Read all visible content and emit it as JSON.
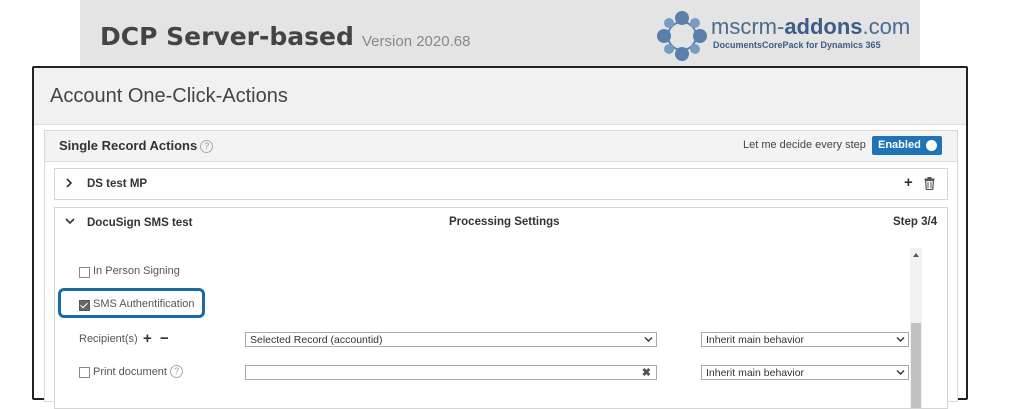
{
  "app": {
    "title": "DCP Server-based",
    "version": "Version 2020.68",
    "logo_prefix": "mscrm-",
    "logo_bold": "addons",
    "logo_suffix": ".com",
    "logo_tagline": "DocumentsCorePack for Dynamics 365"
  },
  "dialog": {
    "title": "Account One-Click-Actions"
  },
  "single_record_actions": {
    "title": "Single Record Actions",
    "help_icon": "?",
    "let_me_decide_label": "Let me decide every step",
    "toggle_label": "Enabled"
  },
  "actions": [
    {
      "name": "DS test MP",
      "expanded": false
    },
    {
      "name": "DocuSign SMS test",
      "expanded": true,
      "section": "Processing Settings",
      "step": "Step 3/4"
    }
  ],
  "settings": {
    "in_person_signing": {
      "label": "In Person Signing",
      "checked": false
    },
    "sms_authentification": {
      "label": "SMS Authentification",
      "checked": true
    },
    "recipients": {
      "label": "Recipient(s)",
      "add": "+",
      "remove": "−",
      "value": "Selected Record (accountid)",
      "behavior": "Inherit main behavior"
    },
    "print_document": {
      "label": "Print document",
      "help_icon": "?",
      "value": "",
      "clear": "✖",
      "behavior": "Inherit main behavior"
    }
  },
  "colors": {
    "accent": "#1f74b7",
    "highlight": "#1a6aa8"
  }
}
